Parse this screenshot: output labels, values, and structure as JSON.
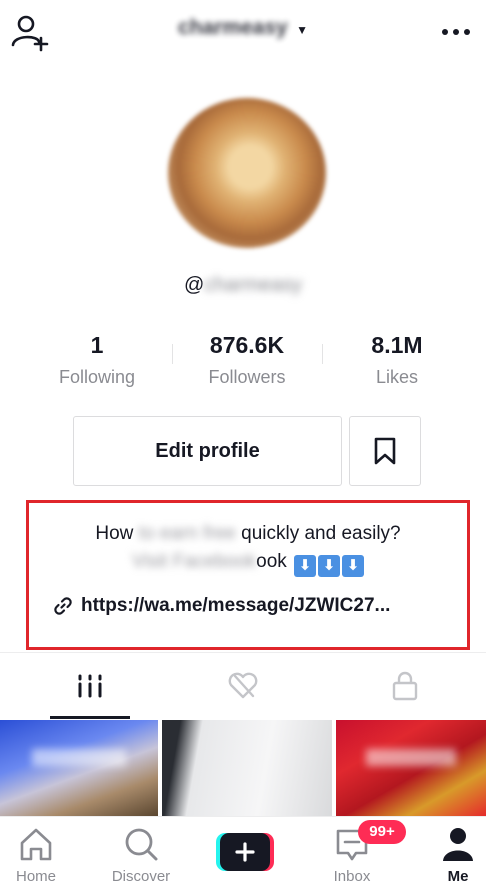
{
  "header": {
    "username": "charmeasy",
    "more_label": "•••"
  },
  "profile": {
    "handle_prefix": "@",
    "handle_rest": "charmeasy"
  },
  "stats": [
    {
      "value": "1",
      "label": "Following"
    },
    {
      "value": "876.6K",
      "label": "Followers"
    },
    {
      "value": "8.1M",
      "label": "Likes"
    }
  ],
  "actions": {
    "edit_profile": "Edit profile"
  },
  "bio": {
    "line1_start": "How ",
    "line1_hidden": "to earn free ",
    "line1_end": "quickly and easily?",
    "line2_hidden": "Visit Facebook",
    "line2_visible": "ook",
    "arrows": [
      "⬇",
      "⬇",
      "⬇"
    ],
    "link": "https://wa.me/message/JZWIC27..."
  },
  "bottom_nav": {
    "home": "Home",
    "discover": "Discover",
    "inbox": "Inbox",
    "inbox_badge": "99+",
    "me": "Me"
  },
  "colors": {
    "accent": "#fe2c55",
    "highlight_border": "#e0262b",
    "text": "#161823",
    "muted": "#8a8b91"
  }
}
